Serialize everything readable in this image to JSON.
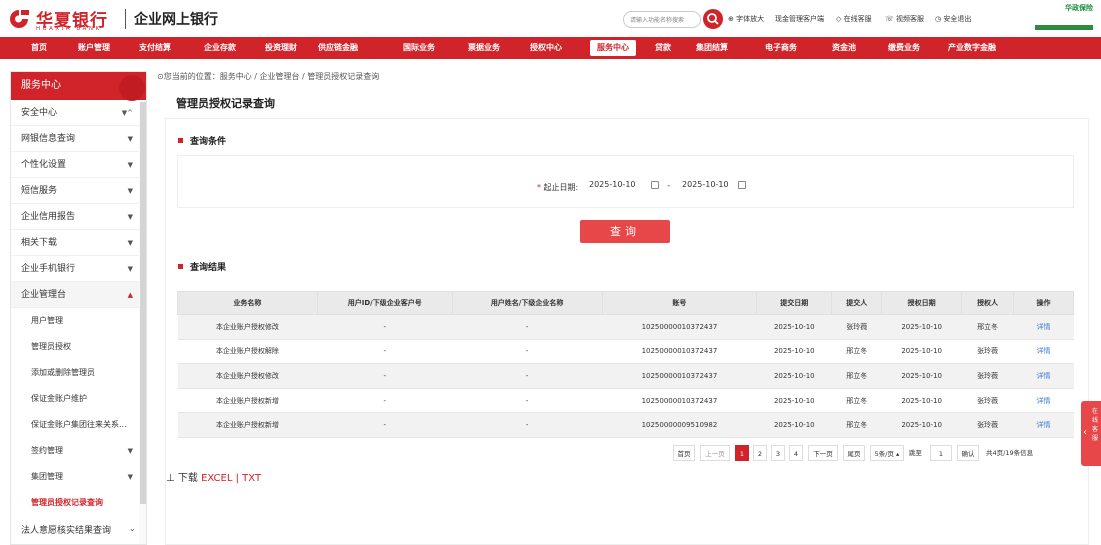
{
  "header": {
    "brand_cn": "华夏银行",
    "brand_en": "HUAXIA BANK",
    "brand_sub": "企业网上银行",
    "search_placeholder": "请输入功能名称搜索",
    "top_links": [
      "字体放大",
      "现金管理客户端",
      "在线客服",
      "视频客服",
      "安全退出"
    ],
    "right_logo": "华政保险"
  },
  "nav": {
    "items": [
      "首页",
      "账户管理",
      "支付结算",
      "企业存款",
      "投资理财",
      "供应链金融",
      "国际业务",
      "票据业务",
      "授权中心",
      "服务中心",
      "贷款",
      "集团结算",
      "电子商务",
      "资金池",
      "缴费业务",
      "产业数字金融"
    ],
    "active": "服务中心"
  },
  "sidebar": {
    "title": "服务中心",
    "items": [
      "安全中心",
      "网银信息查询",
      "个性化设置",
      "短信服务",
      "企业信用报告",
      "相关下载",
      "企业手机银行",
      "企业管理台"
    ],
    "sub_items": [
      "用户管理",
      "管理员授权",
      "添加或删除管理员",
      "保证金账户维护",
      "保证金账户集团往来关系...",
      "签约管理",
      "集团管理",
      "管理员授权记录查询"
    ],
    "active_sub": "管理员授权记录查询",
    "last_item": "法人意愿核实结果查询"
  },
  "main": {
    "breadcrumb": "您当前的位置：服务中心 / 企业管理台 / 管理员授权记录查询",
    "page_title": "管理员授权记录查询",
    "cond_title": "查询条件",
    "date_label": "起止日期:",
    "date_start": "2025-10-10",
    "date_end": "2025-10-10",
    "query_button": "查询",
    "result_title": "查询结果",
    "table": {
      "headers": [
        "业务名称",
        "用户ID/下级企业客户号",
        "用户姓名/下级企业名称",
        "账号",
        "提交日期",
        "提交人",
        "授权日期",
        "授权人",
        "操作"
      ],
      "rows": [
        [
          "本企业账户授权修改",
          "-",
          "-",
          "10250000010372437",
          "2025-10-10",
          "张玲薇",
          "2025-10-10",
          "邢立冬",
          "详情"
        ],
        [
          "本企业账户授权解除",
          "-",
          "-",
          "10250000010372437",
          "2025-10-10",
          "邢立冬",
          "2025-10-10",
          "张玲薇",
          "详情"
        ],
        [
          "本企业账户授权修改",
          "-",
          "-",
          "10250000010372437",
          "2025-10-10",
          "邢立冬",
          "2025-10-10",
          "张玲薇",
          "详情"
        ],
        [
          "本企业账户授权新增",
          "-",
          "-",
          "10250000010372437",
          "2025-10-10",
          "邢立冬",
          "2025-10-10",
          "张玲薇",
          "详情"
        ],
        [
          "本企业账户授权新增",
          "-",
          "-",
          "10250000009510982",
          "2025-10-10",
          "邢立冬",
          "2025-10-10",
          "张玲薇",
          "详情"
        ]
      ]
    },
    "pager": {
      "first": "首页",
      "prev": "上一页",
      "pages": [
        "1",
        "2",
        "3",
        "4"
      ],
      "current": "1",
      "next": "下一页",
      "last": "尾页",
      "page_size": "5条/页",
      "goto_label": "跳至",
      "goto_value": "1",
      "confirm": "确认",
      "summary": "共4页/19条信息"
    },
    "download": {
      "label": "下载",
      "excel": "EXCEL",
      "sep": "|",
      "txt": "TXT"
    }
  },
  "float_tab": "在线客服",
  "colors": {
    "brand_red": "#d0242a",
    "link_blue": "#3a7bd5"
  }
}
